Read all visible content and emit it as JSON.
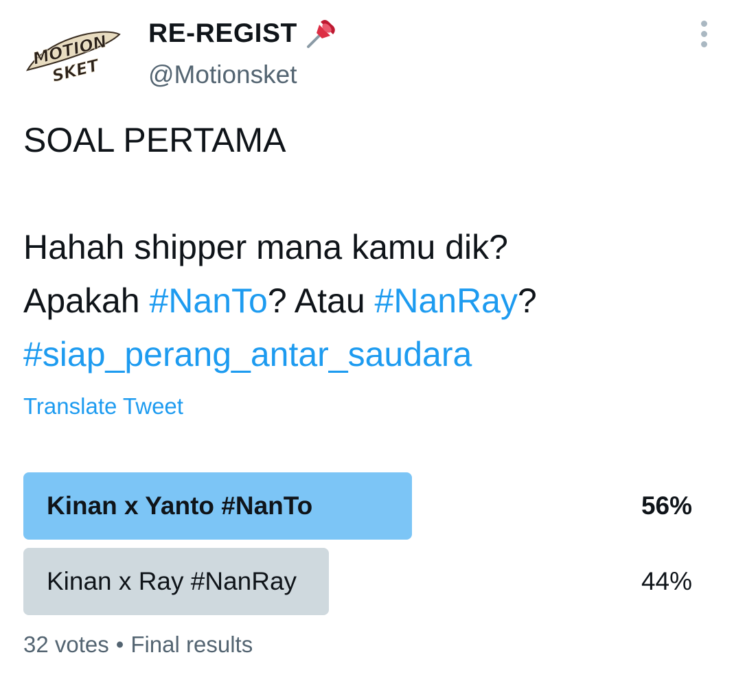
{
  "user": {
    "display_name": "RE-REGIST",
    "handle": "@Motionsket",
    "avatar_text": [
      "MOTION",
      "SKET"
    ],
    "avatar_icon": "motionsket-logo",
    "pin_icon": "pushpin-icon"
  },
  "tweet": {
    "title": "SOAL PERTAMA",
    "line1": "Hahah shipper mana kamu dik?",
    "line2_prefix": "Apakah ",
    "hashtag1": "#NanTo",
    "line2_middle": "? Atau ",
    "hashtag2": "#NanRay",
    "line2_suffix": "?",
    "hashtag3": "#siap_perang_antar_saudara",
    "translate_label": "Translate Tweet"
  },
  "poll": {
    "options": [
      {
        "label": "Kinan x Yanto #NanTo",
        "percent_text": "56%",
        "percent": 56,
        "color": "#7cc5f6",
        "winner": true
      },
      {
        "label": "Kinan x Ray #NanRay",
        "percent_text": "44%",
        "percent": 44,
        "color": "#cfd9de",
        "winner": false
      }
    ],
    "votes": "32 votes",
    "separator": "•",
    "status": "Final results"
  },
  "colors": {
    "accent": "#1d9bf0",
    "secondary_text": "#536471",
    "winner_bar": "#7cc5f6",
    "loser_bar": "#cfd9de"
  }
}
